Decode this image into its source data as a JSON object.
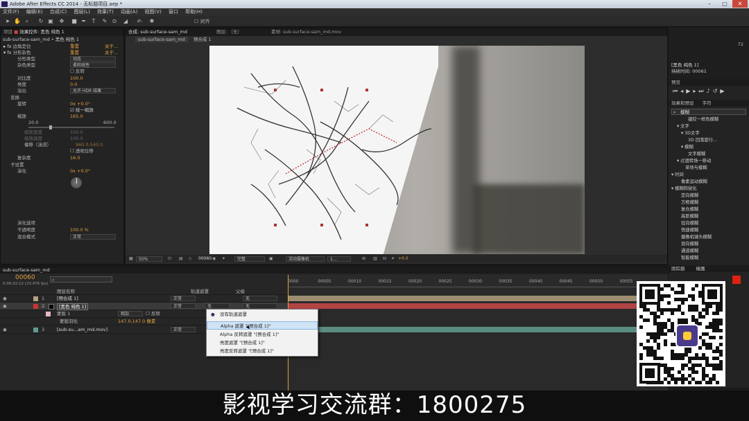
{
  "window": {
    "title": "Adobe After Effects CC 2014 - 无标题项目.aep *"
  },
  "menu": [
    "文件(F)",
    "编辑(E)",
    "合成(C)",
    "图层(L)",
    "效果(T)",
    "动画(A)",
    "视图(V)",
    "窗口",
    "帮助(H)"
  ],
  "toolbar": {
    "snap_label": "对齐"
  },
  "left_panel": {
    "tabs": {
      "project": "项目",
      "effects_controls": "效果控件: 黑色 纯色 1"
    },
    "breadcrumb": "sub-surface-sam_md • 黑色 纯色 1",
    "fx_reset": "重置",
    "fx_about": "关于...",
    "rows": [
      {
        "label": "边角定位",
        "value": "重置",
        "extra": "关于..."
      },
      {
        "label": "分形杂色",
        "value": "重置",
        "extra": "关于..."
      },
      {
        "label": "分形类型",
        "value": "动态"
      },
      {
        "label": "杂色类型",
        "value": "柔和线性"
      },
      {
        "label": "",
        "value": "反转"
      },
      {
        "label": "对比度",
        "value": "100.0"
      },
      {
        "label": "亮度",
        "value": "0.0"
      },
      {
        "label": "溢出",
        "value": "允许 HDR 结果"
      },
      {
        "label": "变换",
        "value": ""
      },
      {
        "label": "旋转",
        "value": "0x +0.0°"
      },
      {
        "label": "",
        "value": "统一缩放"
      },
      {
        "label": "缩放",
        "value": "165.0"
      },
      {
        "label": "",
        "value": "20.0",
        "extra": "600.0"
      },
      {
        "label": "缩放宽度",
        "value": "100.0"
      },
      {
        "label": "缩放高度",
        "value": "100.0"
      },
      {
        "label": "偏移（湍流）",
        "value": "960.0,540.0"
      },
      {
        "label": "",
        "value": "透视位移"
      },
      {
        "label": "复杂度",
        "value": "16.0"
      },
      {
        "label": "子设置",
        "value": ""
      },
      {
        "label": "演化",
        "value": "0x +0.0°"
      },
      {
        "label": "演化选项",
        "value": ""
      },
      {
        "label": "不透明度",
        "value": "100.0 %"
      },
      {
        "label": "混合模式",
        "value": "正常"
      }
    ]
  },
  "viewer": {
    "tabs": {
      "comp": "合成: sub-surface-sam_md",
      "layer": "图层: （无）",
      "footage": "素材: sub-surface-sam_md.mov"
    },
    "subtabs": [
      "sub-surface-sam_md",
      "预合成 1"
    ],
    "bar": {
      "zoom": "50%",
      "timecode": "00060",
      "resolution": "完整",
      "camera": "活动摄像机",
      "views": "1...",
      "exposure": "+0.0"
    }
  },
  "right_panel": {
    "info_number": "72",
    "info_layer": "[黑色 纯色 1]",
    "info_duration": "持续时间: 00061",
    "preview_tab": "预览",
    "effects_tabs": [
      "效果和预设",
      "字符"
    ],
    "search_value": "模糊",
    "tree": [
      "键控一样色模糊",
      "▾ 文字",
      "▾ 3D文字",
      "3D 回落旋行...",
      "▾ 模糊",
      "文字模糊",
      "▾ 过渡转场一移动",
      "单项与模糊",
      "▾ 时间",
      "像素运动模糊",
      "▾ 模糊和锐化",
      "定向模糊",
      "方框模糊",
      "复合模糊",
      "高斯模糊",
      "径向模糊",
      "快速模糊",
      "摄像机镜头模糊",
      "双向模糊",
      "通道模糊",
      "智能模糊"
    ],
    "bottom_tabs": [
      "跟踪器",
      "绘画"
    ]
  },
  "timeline": {
    "tab": "sub-surface-sam_md",
    "timecode": "00060",
    "timecode_sub": "0:00:02:12 (23.976 fps)",
    "col_layer": "图层名称",
    "col_trkmat": "轨道遮罩",
    "col_parent": "父级",
    "ruler": [
      "0000",
      "00005",
      "00010",
      "00015",
      "00020",
      "00025",
      "00030",
      "00035",
      "00040",
      "00045",
      "00050",
      "00055"
    ],
    "layers": [
      {
        "num": "1",
        "name": "[预合成 1]",
        "mode": "正常",
        "parent": "无"
      },
      {
        "num": "2",
        "name": "[黑色 纯色 1]",
        "mode": "正常",
        "trkmat": "无",
        "parent": "无"
      },
      {
        "num": "",
        "name": "蒙版 1",
        "mode": "相加",
        "extra": "反转"
      },
      {
        "num": "",
        "name": "蒙版羽化",
        "mode": "147.0,147.0 像素"
      },
      {
        "num": "3",
        "name": "[sub-su...am_md.mov]",
        "mode": "正常",
        "parent": "无"
      }
    ]
  },
  "popup": {
    "items": [
      "没有轨道遮罩",
      "Alpha 遮罩 \"[预合成 1]\"",
      "Alpha 反转遮罩 \"[预合成 1]\"",
      "亮度遮罩 \"[预合成 1]\"",
      "亮度反转遮罩 \"[预合成 1]\""
    ]
  },
  "caption": "影视学习交流群：1800275"
}
